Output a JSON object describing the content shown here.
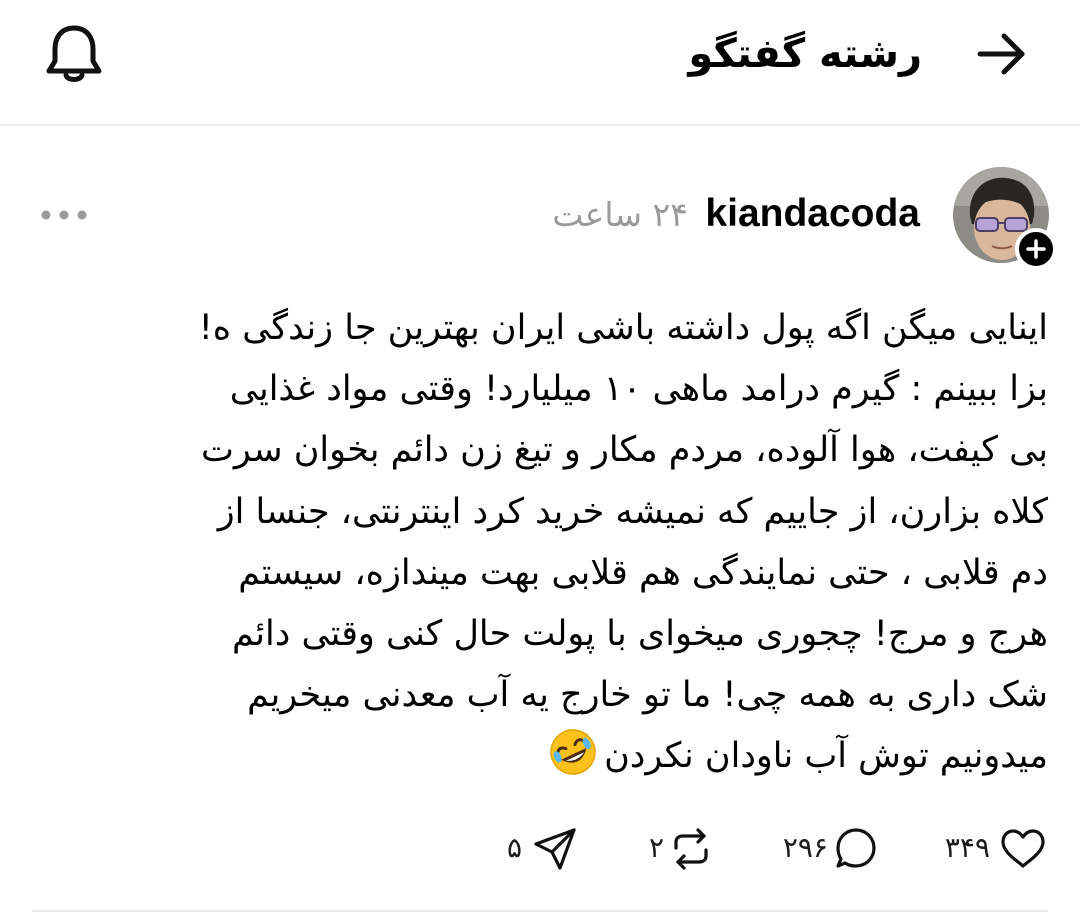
{
  "header": {
    "title": "رشته گفتگو",
    "back_icon": "arrow-right-icon",
    "notification_icon": "bell-icon"
  },
  "post": {
    "username": "kiandacoda",
    "time": "۲۴ ساعت",
    "more_icon": "more-dots-icon",
    "avatar_icon": "avatar",
    "follow_icon": "plus-icon",
    "lines": [
      "اینایی میگن اگه پول داشته باشی ایران بهترین جا زندگی ه!",
      "بزا ببینم :  گیرم درامد ماهی ۱۰ میلیارد!  وقتی  مواد  غذایی",
      "بی کیفت،   هوا آلوده، مردم مکار و تیغ زن  دائم بخوان سرت",
      "کلاه بزارن،  از جاییم که نمیشه خرید کرد اینترنتی، جنسا از",
      "دم قلابی ،  حتی  نمایندگی هم قلابی بهت میندازه، سیستم",
      "هرج و مرج!  چجوری میخوای با پولت حال کنی وقتی دائم",
      "شک داری به همه چی!  ما تو خارج یه آب معدنی میخریم",
      "میدونیم توش  آب  ناودان نکردن"
    ],
    "emoji_icon": "rolling-laughing-emoji-icon"
  },
  "actions": {
    "like": {
      "count": "۳۴۹",
      "icon": "heart-icon"
    },
    "reply": {
      "count": "۲۹۶",
      "icon": "comment-icon"
    },
    "repost": {
      "count": "۲",
      "icon": "repost-icon"
    },
    "share": {
      "count": "۵",
      "icon": "send-icon"
    }
  }
}
